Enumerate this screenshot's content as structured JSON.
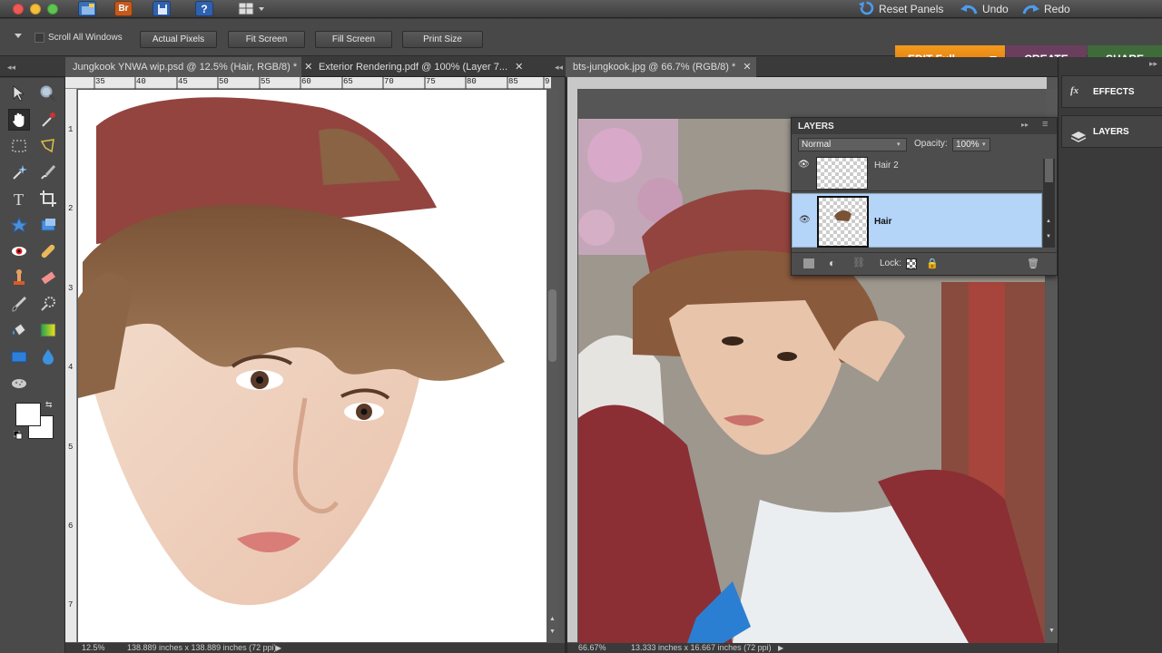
{
  "menubar": {
    "reset_panels": "Reset Panels",
    "undo": "Undo",
    "redo": "Redo",
    "bridge_label": "Br"
  },
  "options": {
    "scroll_all_windows": "Scroll All Windows",
    "buttons": [
      "Actual Pixels",
      "Fit Screen",
      "Fill Screen",
      "Print Size"
    ]
  },
  "modes": {
    "edit": "EDIT Full",
    "create": "CREATE",
    "share": "SHARE"
  },
  "tabs": {
    "doc1": "Jungkook YNWA wip.psd @ 12.5% (Hair, RGB/8) *",
    "doc2": "Exterior Rendering.pdf @ 100% (Layer 7...",
    "doc3": "bts-jungkook.jpg @ 66.7% (RGB/8) *",
    "close": "✕"
  },
  "ruler_left": {
    "top_ticks": [
      "35",
      "40",
      "45",
      "50",
      "55",
      "60",
      "65",
      "70",
      "75",
      "80",
      "85",
      "9"
    ],
    "side_ticks": [
      "1",
      "2",
      "3",
      "4",
      "5",
      "6",
      "7"
    ]
  },
  "status": {
    "left_zoom": "12.5%",
    "left_size": "138.889 inches x 138.889 inches (72 ppi)",
    "right_zoom": "66.67%",
    "right_size": "13.333 inches x 16.667 inches (72 ppi)"
  },
  "layers_panel": {
    "title": "LAYERS",
    "blend_mode": "Normal",
    "opacity_label": "Opacity:",
    "opacity_value": "100%",
    "lock_label": "Lock:",
    "layers": [
      {
        "name": "Hair 2",
        "selected": false
      },
      {
        "name": "Hair",
        "selected": true
      }
    ]
  },
  "dock": {
    "effects": "EFFECTS",
    "layers": "LAYERS"
  },
  "colors": {
    "accent_orange": "#e8830a",
    "create_purple": "#6a3a5a",
    "share_green": "#3d6a3a",
    "layer_selected": "#b4d4f8",
    "hat_red": "#93443f"
  }
}
